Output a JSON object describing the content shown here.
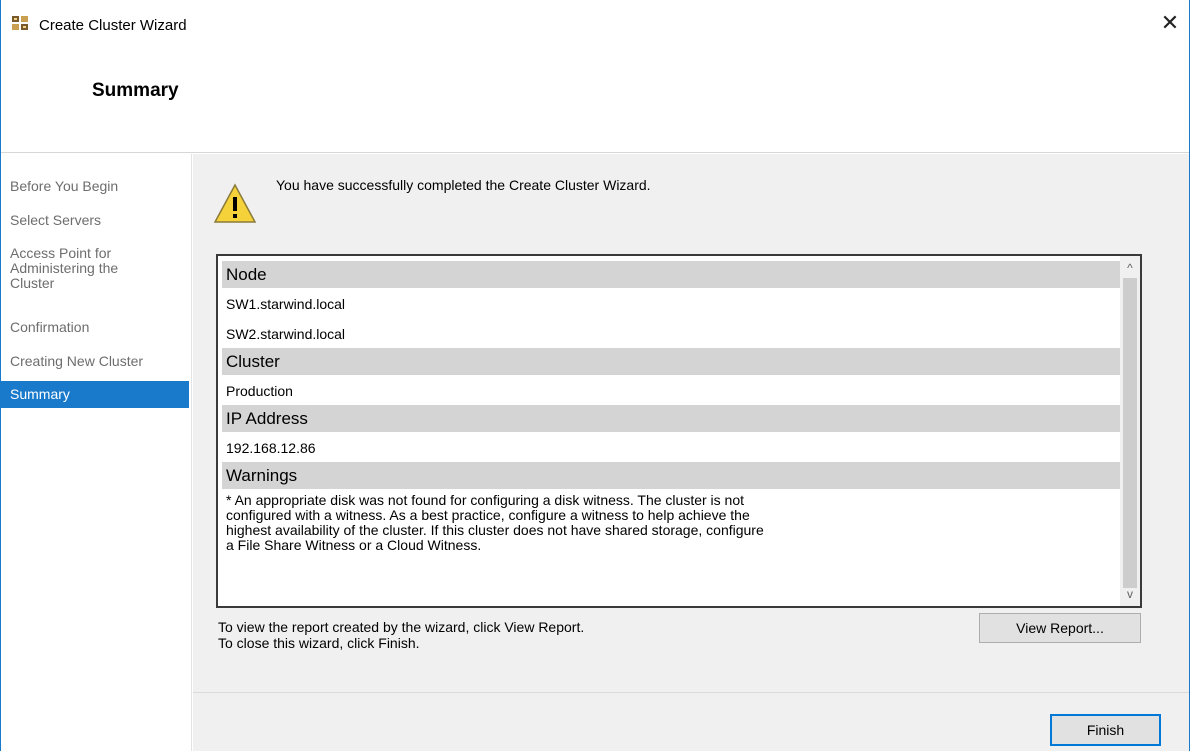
{
  "window": {
    "title": "Create Cluster Wizard",
    "close_glyph": "✕"
  },
  "header": {
    "title": "Summary"
  },
  "nav": {
    "items": [
      {
        "label": "Before You Begin"
      },
      {
        "label": "Select Servers"
      },
      {
        "label": "Access Point for Administering the Cluster"
      },
      {
        "label": "Confirmation"
      },
      {
        "label": "Creating New Cluster"
      },
      {
        "label": "Summary",
        "selected": true
      }
    ]
  },
  "main": {
    "message": "You have successfully completed the Create Cluster Wizard.",
    "status_icon": "warning-icon",
    "report": {
      "node_heading": "Node",
      "nodes": [
        "SW1.starwind.local",
        "SW2.starwind.local"
      ],
      "cluster_heading": "Cluster",
      "cluster": "Production",
      "ip_heading": "IP Address",
      "ip": "192.168.12.86",
      "warnings_heading": "Warnings",
      "warnings_text": " * An appropriate disk was not found for configuring a disk witness. The cluster is not configured with a witness. As a best practice, configure a witness to help achieve the highest availability of the cluster. If this cluster does not have shared storage, configure a File Share Witness or a Cloud Witness."
    },
    "hint_line1": "To view the report created by the wizard, click View Report.",
    "hint_line2": "To close this wizard, click Finish.",
    "view_report_label": "View Report...",
    "finish_label": "Finish"
  },
  "colors": {
    "accent": "#1979ca",
    "section_header_bg": "#d4d4d4",
    "panel_bg": "#f0f0f0"
  }
}
